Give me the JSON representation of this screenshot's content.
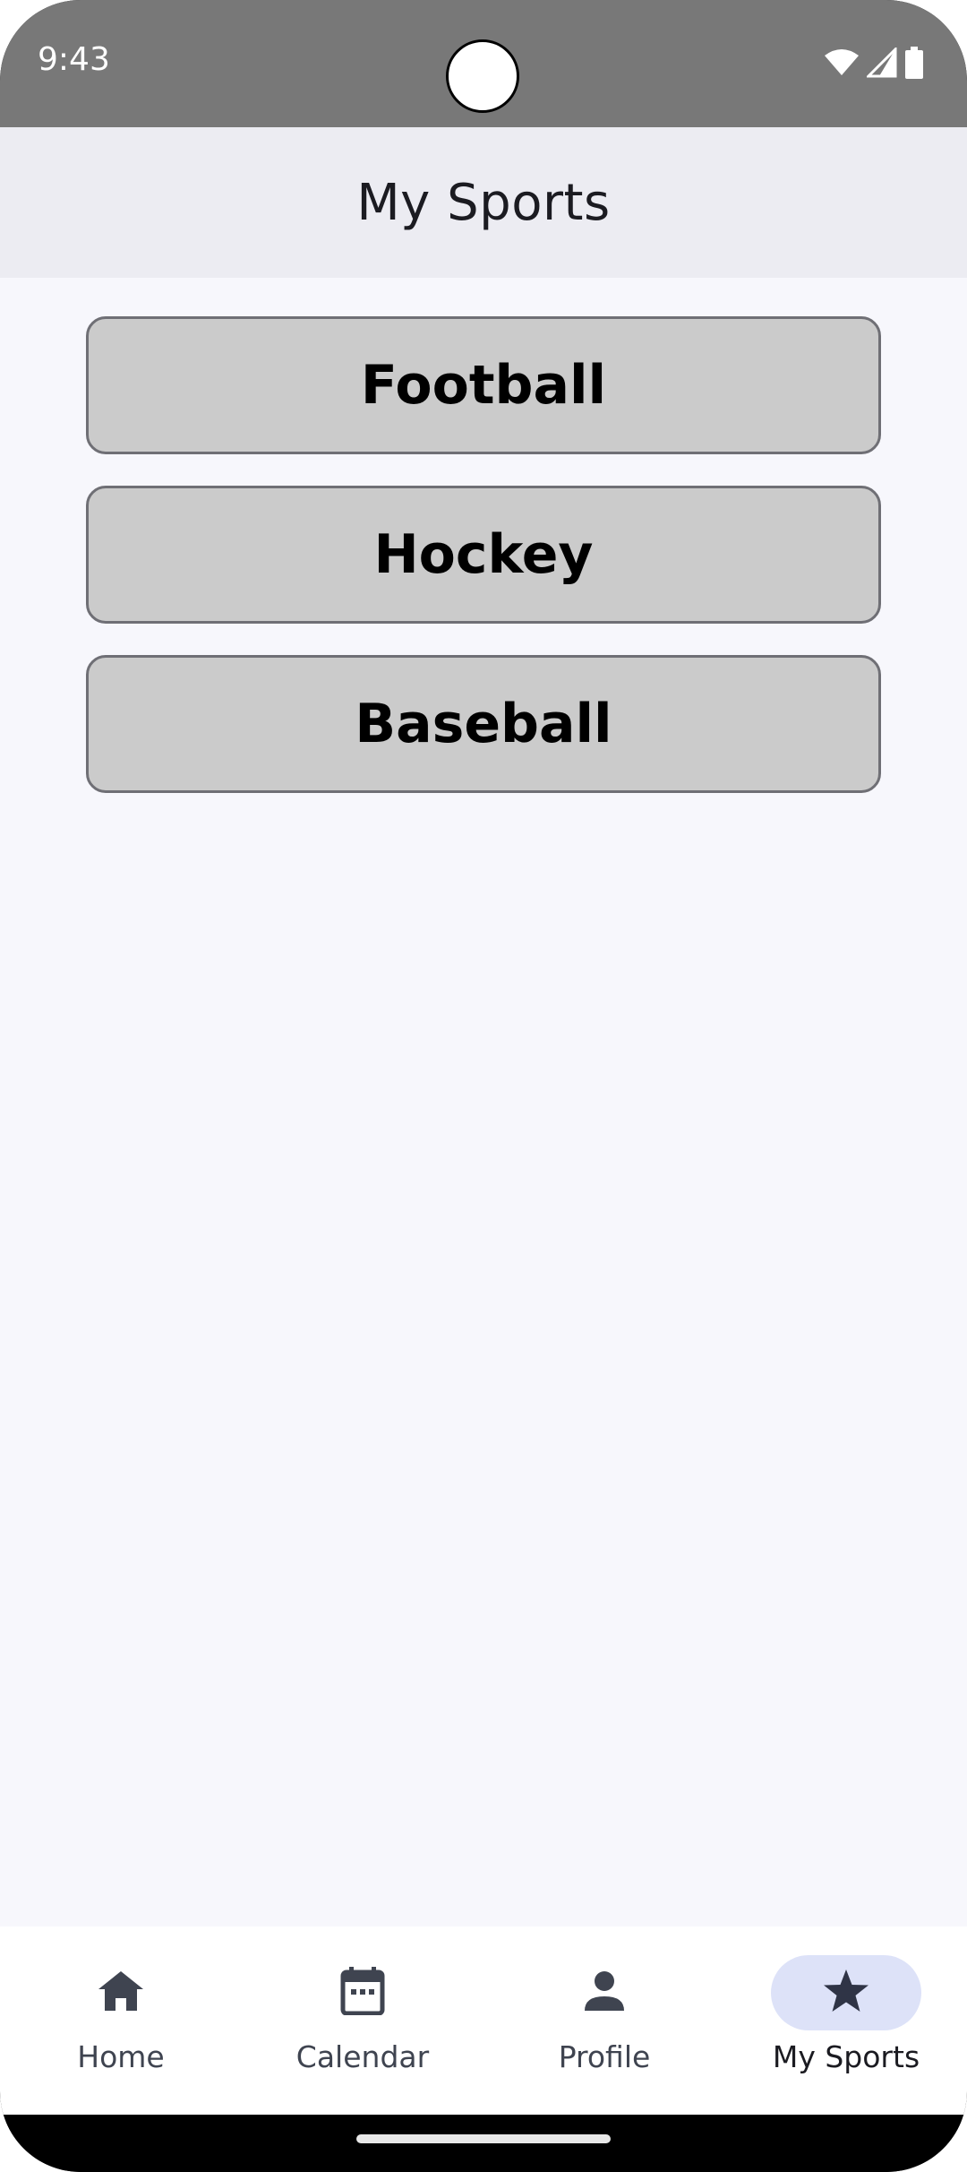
{
  "status_bar": {
    "time": "9:43",
    "icons": [
      "wifi-icon",
      "signal-icon",
      "battery-icon"
    ]
  },
  "app_bar": {
    "title": "My Sports"
  },
  "sports": [
    {
      "label": "Football"
    },
    {
      "label": "Hockey"
    },
    {
      "label": "Baseball"
    }
  ],
  "bottom_nav": {
    "items": [
      {
        "label": "Home",
        "icon": "home-icon",
        "active": false
      },
      {
        "label": "Calendar",
        "icon": "calendar-icon",
        "active": false
      },
      {
        "label": "Profile",
        "icon": "person-icon",
        "active": false
      },
      {
        "label": "My Sports",
        "icon": "star-icon",
        "active": true
      }
    ]
  },
  "colors": {
    "status_bar": "#787878",
    "app_bar": "#ececf2",
    "content_bg": "#f7f7fc",
    "sport_button_bg": "#cbcbcb",
    "nav_active_indicator": "#dde2f8",
    "nav_icon": "#3f4450"
  }
}
